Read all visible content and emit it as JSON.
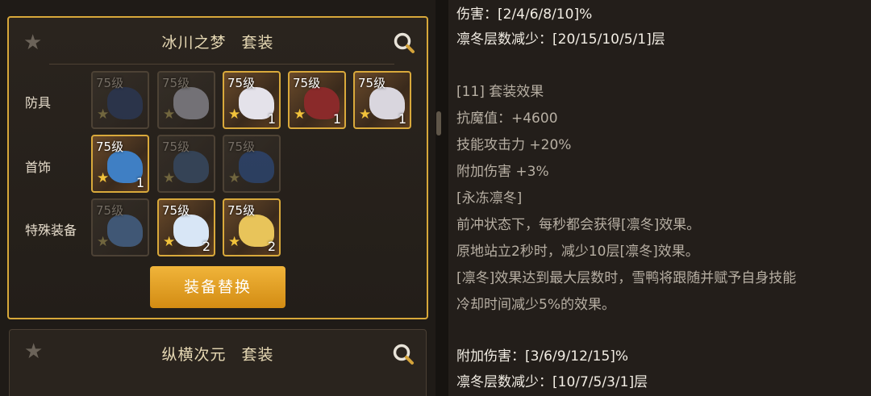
{
  "left_panel": {
    "set1": {
      "name": "冰川之梦",
      "suffix": "套装",
      "rows": [
        {
          "label": "防具",
          "items": [
            {
              "level": "75级",
              "count": "",
              "owned": false
            },
            {
              "level": "75级",
              "count": "",
              "owned": false
            },
            {
              "level": "75级",
              "count": "1",
              "owned": true
            },
            {
              "level": "75级",
              "count": "1",
              "owned": true
            },
            {
              "level": "75级",
              "count": "1",
              "owned": true
            }
          ]
        },
        {
          "label": "首饰",
          "items": [
            {
              "level": "75级",
              "count": "1",
              "owned": true
            },
            {
              "level": "75级",
              "count": "",
              "owned": false
            },
            {
              "level": "75级",
              "count": "",
              "owned": false
            }
          ]
        },
        {
          "label": "特殊装备",
          "items": [
            {
              "level": "75级",
              "count": "",
              "owned": false
            },
            {
              "level": "75级",
              "count": "2",
              "owned": true
            },
            {
              "level": "75级",
              "count": "2",
              "owned": true
            }
          ]
        }
      ],
      "swap_button": "装备替换"
    },
    "set2": {
      "name": "纵横次元",
      "suffix": "套装"
    }
  },
  "right_panel": {
    "lines": [
      {
        "text": "伤害：[2/4/6/8/10]%",
        "style": "w"
      },
      {
        "text": "凛冬层数减少：[20/15/10/5/1]层",
        "style": "w"
      },
      {
        "text": "[11] 套装效果",
        "style": "g"
      },
      {
        "text": "抗魔值：+4600",
        "style": "g"
      },
      {
        "text": "技能攻击力 +20%",
        "style": "g"
      },
      {
        "text": "附加伤害 +3%",
        "style": "g"
      },
      {
        "text": "[永冻凛冬]",
        "style": "g"
      },
      {
        "text": "前冲状态下，每秒都会获得[凛冬]效果。",
        "style": "g"
      },
      {
        "text": "原地站立2秒时，减少10层[凛冬]效果。",
        "style": "g"
      },
      {
        "text": "[凛冬]效果达到最大层数时，雪鸭将跟随并赋予自身技能",
        "style": "g"
      },
      {
        "text": "冷却时间减少5%的效果。",
        "style": "g"
      },
      {
        "text": "附加伤害：[3/6/9/12/15]%",
        "style": "w"
      },
      {
        "text": "凛冬层数减少：[10/7/5/3/1]层",
        "style": "w"
      }
    ]
  },
  "colors": {
    "gold_border": "#d7a83a",
    "button": "#e0a024",
    "title_text": "#e7d9b4"
  }
}
